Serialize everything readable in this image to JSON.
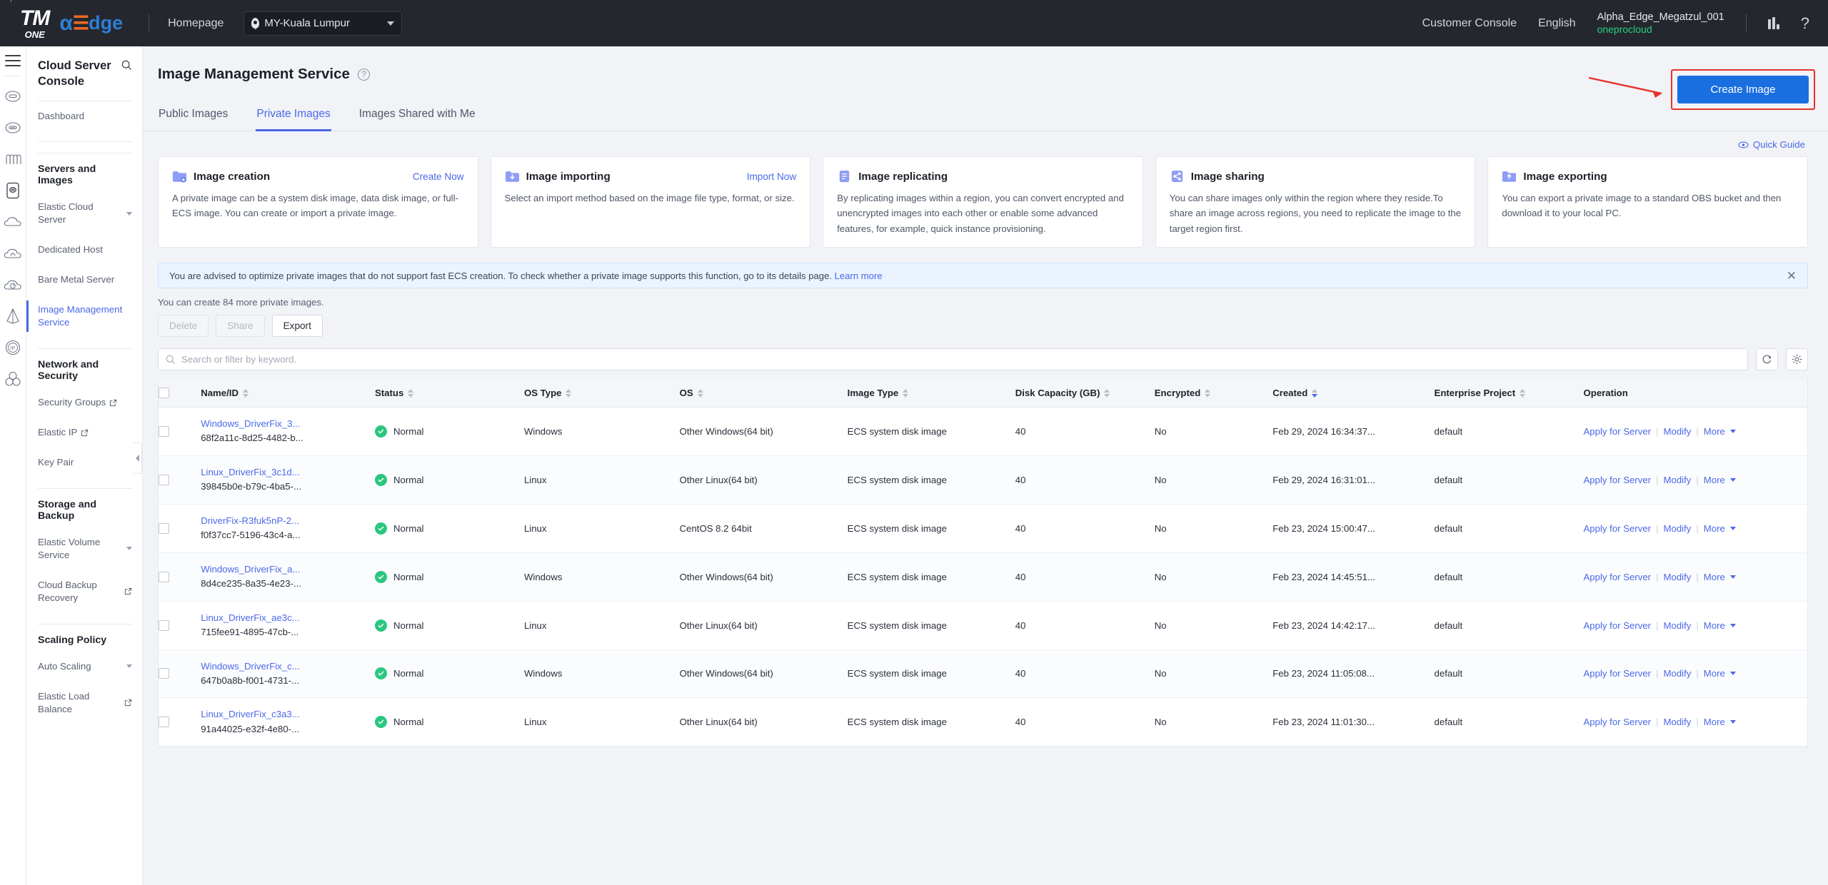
{
  "topbar": {
    "logo_tm": "TM",
    "logo_one": "ONE",
    "logo_alpha_a": "α",
    "logo_alpha_e": "☰",
    "logo_alpha_dge": "dge",
    "homepage": "Homepage",
    "region": "MY-Kuala Lumpur",
    "customer_console": "Customer Console",
    "language": "English",
    "account_name": "Alpha_Edge_Megatzul_001",
    "account_sub": "oneprocloud"
  },
  "nav": {
    "title": "Cloud Server Console",
    "items": [
      {
        "label": "Dashboard",
        "type": "item"
      },
      {
        "label": "Servers and Images",
        "type": "group"
      },
      {
        "label": "Elastic Cloud Server",
        "type": "item",
        "arrow": true
      },
      {
        "label": "Dedicated Host",
        "type": "item"
      },
      {
        "label": "Bare Metal Server",
        "type": "item"
      },
      {
        "label": "Image Management Service",
        "type": "item",
        "active": true
      },
      {
        "label": "Network and Security",
        "type": "group"
      },
      {
        "label": "Security Groups",
        "type": "item",
        "external": true
      },
      {
        "label": "Elastic IP",
        "type": "item",
        "external": true
      },
      {
        "label": "Key Pair",
        "type": "item"
      },
      {
        "label": "Storage and Backup",
        "type": "group"
      },
      {
        "label": "Elastic Volume Service",
        "type": "item",
        "arrow": true
      },
      {
        "label": "Cloud Backup Recovery",
        "type": "item",
        "external": true
      },
      {
        "label": "Scaling Policy",
        "type": "group"
      },
      {
        "label": "Auto Scaling",
        "type": "item",
        "arrow": true
      },
      {
        "label": "Elastic Load Balance",
        "type": "item",
        "external": true
      }
    ]
  },
  "page": {
    "title": "Image Management Service",
    "create_button": "Create Image",
    "quick_guide": "Quick Guide",
    "quota_text": "You can create 84 more private images."
  },
  "tabs": [
    {
      "label": "Public Images",
      "active": false
    },
    {
      "label": "Private Images",
      "active": true
    },
    {
      "label": "Images Shared with Me",
      "active": false
    }
  ],
  "cards": [
    {
      "icon": "folder-plus-icon",
      "title": "Image creation",
      "link": "Create Now",
      "desc": "A private image can be a system disk image, data disk image, or full-ECS image. You can create or import a private image."
    },
    {
      "icon": "folder-down-icon",
      "title": "Image importing",
      "link": "Import Now",
      "desc": "Select an import method based on the image file type, format, or size."
    },
    {
      "icon": "document-icon",
      "title": "Image replicating",
      "link": "",
      "desc": "By replicating images within a region, you can convert encrypted and unencrypted images into each other or enable some advanced features, for example, quick instance provisioning."
    },
    {
      "icon": "share-icon",
      "title": "Image sharing",
      "link": "",
      "desc": "You can share images only within the region where they reside.To share an image across regions, you need to replicate the image to the target region first."
    },
    {
      "icon": "folder-up-icon",
      "title": "Image exporting",
      "link": "",
      "desc": "You can export a private image to a standard OBS bucket and then download it to your local PC."
    }
  ],
  "banner": {
    "text": "You are advised to optimize private images that do not support fast ECS creation. To check whether a private image supports this function, go to its details page.",
    "link": "Learn more"
  },
  "toolbar": {
    "delete_label": "Delete",
    "share_label": "Share",
    "export_label": "Export"
  },
  "search": {
    "placeholder": "Search or filter by keyword.",
    "value": ""
  },
  "table": {
    "columns": [
      {
        "label": "Name/ID",
        "sortable": true
      },
      {
        "label": "Status",
        "sortable": true
      },
      {
        "label": "OS Type",
        "sortable": true
      },
      {
        "label": "OS",
        "sortable": true
      },
      {
        "label": "Image Type",
        "sortable": true
      },
      {
        "label": "Disk Capacity (GB)",
        "sortable": true
      },
      {
        "label": "Encrypted",
        "sortable": true
      },
      {
        "label": "Created",
        "sortable": true,
        "sorted": "desc"
      },
      {
        "label": "Enterprise Project",
        "sortable": true
      },
      {
        "label": "Operation",
        "sortable": false
      }
    ],
    "op_labels": {
      "apply": "Apply for Server",
      "modify": "Modify",
      "more": "More"
    },
    "rows": [
      {
        "name": "Windows_DriverFix_3...",
        "id": "68f2a11c-8d25-4482-b...",
        "status": "Normal",
        "os_type": "Windows",
        "os": "Other Windows(64 bit)",
        "image_type": "ECS system disk image",
        "disk": "40",
        "encrypted": "No",
        "created": "Feb 29, 2024 16:34:37...",
        "enterprise_project": "default"
      },
      {
        "name": "Linux_DriverFix_3c1d...",
        "id": "39845b0e-b79c-4ba5-...",
        "status": "Normal",
        "os_type": "Linux",
        "os": "Other Linux(64 bit)",
        "image_type": "ECS system disk image",
        "disk": "40",
        "encrypted": "No",
        "created": "Feb 29, 2024 16:31:01...",
        "enterprise_project": "default"
      },
      {
        "name": "DriverFix-R3fuk5nP-2...",
        "id": "f0f37cc7-5196-43c4-a...",
        "status": "Normal",
        "os_type": "Linux",
        "os": "CentOS 8.2 64bit",
        "image_type": "ECS system disk image",
        "disk": "40",
        "encrypted": "No",
        "created": "Feb 23, 2024 15:00:47...",
        "enterprise_project": "default"
      },
      {
        "name": "Windows_DriverFix_a...",
        "id": "8d4ce235-8a35-4e23-...",
        "status": "Normal",
        "os_type": "Windows",
        "os": "Other Windows(64 bit)",
        "image_type": "ECS system disk image",
        "disk": "40",
        "encrypted": "No",
        "created": "Feb 23, 2024 14:45:51...",
        "enterprise_project": "default"
      },
      {
        "name": "Linux_DriverFix_ae3c...",
        "id": "715fee91-4895-47cb-...",
        "status": "Normal",
        "os_type": "Linux",
        "os": "Other Linux(64 bit)",
        "image_type": "ECS system disk image",
        "disk": "40",
        "encrypted": "No",
        "created": "Feb 23, 2024 14:42:17...",
        "enterprise_project": "default"
      },
      {
        "name": "Windows_DriverFix_c...",
        "id": "647b0a8b-f001-4731-...",
        "status": "Normal",
        "os_type": "Windows",
        "os": "Other Windows(64 bit)",
        "image_type": "ECS system disk image",
        "disk": "40",
        "encrypted": "No",
        "created": "Feb 23, 2024 11:05:08...",
        "enterprise_project": "default"
      },
      {
        "name": "Linux_DriverFix_c3a3...",
        "id": "91a44025-e32f-4e80-...",
        "status": "Normal",
        "os_type": "Linux",
        "os": "Other Linux(64 bit)",
        "image_type": "ECS system disk image",
        "disk": "40",
        "encrypted": "No",
        "created": "Feb 23, 2024 11:01:30...",
        "enterprise_project": "default"
      }
    ]
  },
  "colors": {
    "accent": "#4b68e8",
    "primary_button": "#1a6fe0",
    "success": "#2bc77f",
    "highlight": "#e8312a",
    "topbar": "#25272f"
  }
}
